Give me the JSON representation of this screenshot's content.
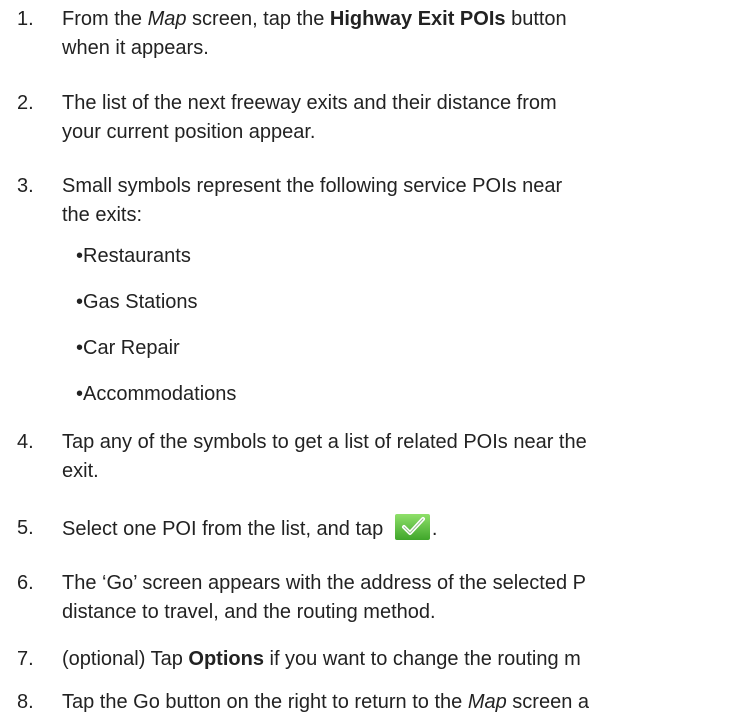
{
  "steps": [
    {
      "num": "1.",
      "line1": {
        "pre": "From the ",
        "italic": "Map",
        "mid": " screen, tap the ",
        "bold": "Highway Exit POIs",
        "post": " button"
      },
      "line2": "when it appears."
    },
    {
      "num": "2.",
      "line1": "The list of the next freeway exits and their distance from",
      "line2": "your current position appear."
    },
    {
      "num": "3.",
      "line1": "Small symbols represent the following service POIs near",
      "line2": "the exits:"
    },
    {
      "num": "4.",
      "line1": "Tap any of the symbols to get a list of related POIs near the",
      "line2": "exit."
    },
    {
      "num": "5.",
      "pre": "Select one POI from the list, and tap ",
      "post": "."
    },
    {
      "num": "6.",
      "line1": "The ‘Go’ screen appears with the address of the selected P",
      "line2": "distance to travel, and the routing method."
    },
    {
      "num": "7.",
      "pre": "(optional) Tap ",
      "bold": "Options",
      "post": " if you want to change the routing m"
    },
    {
      "num": "8.",
      "pre": "Tap the Go button on the right to return to the ",
      "italic": "Map",
      "post": " screen a"
    }
  ],
  "services": [
    "•Restaurants",
    "•Gas Stations",
    "•Car Repair",
    "•Accommodations"
  ],
  "icons": {
    "confirm": "checkmark-icon",
    "confirm_color": "#5cc23c"
  }
}
